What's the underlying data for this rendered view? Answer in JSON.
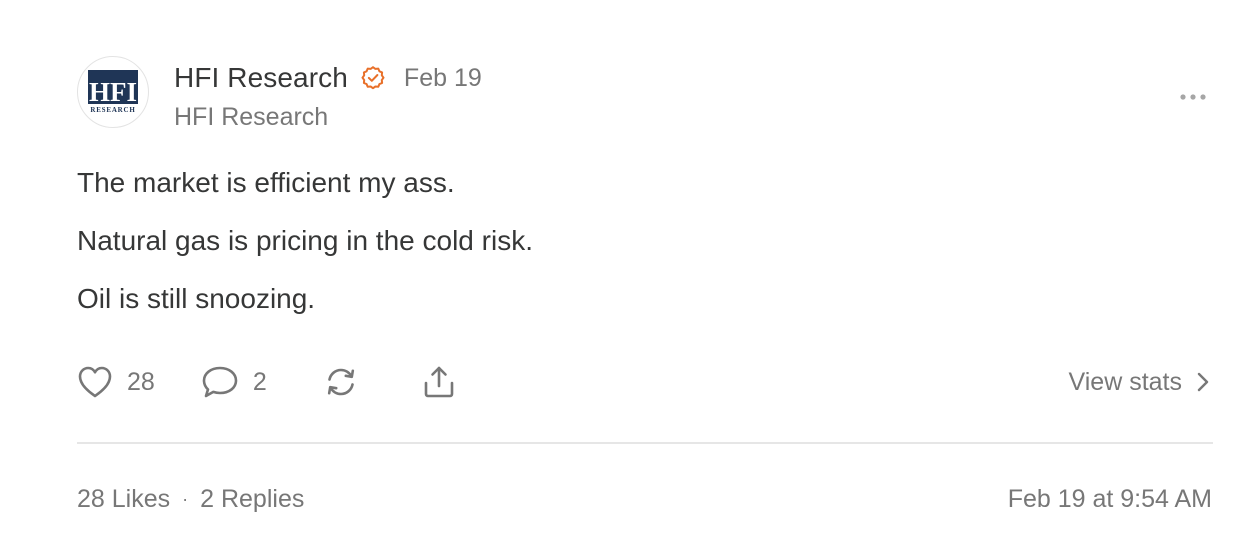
{
  "author": {
    "name": "HFI Research",
    "handle": "HFI Research",
    "date": "Feb 19",
    "verified": true,
    "avatar_text": "HFI",
    "avatar_subtext": "RESEARCH",
    "avatar_color": "#1f3556"
  },
  "post": {
    "lines": [
      "The market is efficient my ass.",
      "Natural gas is pricing in the cold risk.",
      "Oil is still snoozing."
    ]
  },
  "actions": {
    "like_icon": "heart-icon",
    "likes": "28",
    "reply_icon": "speech-bubble-icon",
    "replies": "2",
    "restack_icon": "restack-icon",
    "share_icon": "share-icon",
    "view_stats": "View stats"
  },
  "footer": {
    "likes_label": "28 Likes",
    "separator": "·",
    "replies_label": "2 Replies",
    "timestamp": "Feb 19 at 9:54 AM"
  },
  "colors": {
    "verified_badge": "#e8702a",
    "text_primary": "#363737",
    "text_secondary": "#777777",
    "divider": "#e6e6e6"
  }
}
